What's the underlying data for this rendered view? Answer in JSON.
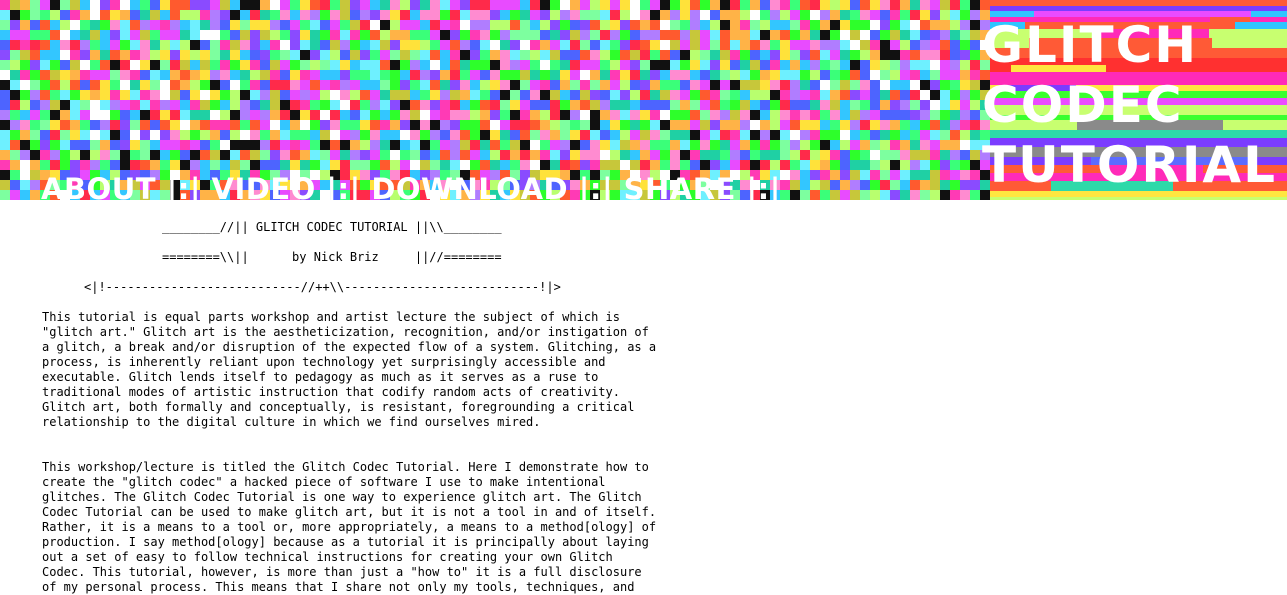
{
  "header": {
    "title_lines": [
      "GLITCH",
      "CODEC",
      "TUTORIAL"
    ],
    "nav": [
      {
        "label": "ABOUT"
      },
      {
        "label": "VIDEO"
      },
      {
        "label": "DOWNLOAD"
      },
      {
        "label": "SHARE"
      }
    ],
    "nav_separator": "|:|",
    "noise_palette": [
      "#ff3ab5",
      "#2dff2a",
      "#33c6ff",
      "#ffe23a",
      "#8a4bff",
      "#ff5a2e",
      "#b8ff6e",
      "#e84bff",
      "#1fd0a4",
      "#ffffff",
      "#4d64ff",
      "#ff8bd0",
      "#6ef0ff",
      "#c7c73a",
      "#ff2a4a",
      "#111111",
      "#7dff9f",
      "#b07dff",
      "#ffb347",
      "#3aff79"
    ],
    "stripe_palette": [
      "#ff2ab8",
      "#39ff2f",
      "#2fc5ff",
      "#ffe640",
      "#7b3cff",
      "#ff5a36",
      "#c8ff70",
      "#ea4bff",
      "#2ed9a9",
      "#ff3030",
      "#5c6bff",
      "#ff9ad2",
      "#8a8a8a"
    ]
  },
  "content": {
    "ascii_line_1": "________//|| GLITCH CODEC TUTORIAL ||\\\\________",
    "ascii_line_2": "========\\\\||      by Nick Briz     ||//========",
    "ascii_line_3": "<|!---------------------------//++\\\\---------------------------!|>",
    "paragraph_1": "This tutorial is equal parts workshop and artist lecture the subject of which is\n\"glitch art.\" Glitch art is the aestheticization, recognition, and/or instigation of\na glitch, a break and/or disruption of the expected flow of a system. Glitching, as a\nprocess, is inherently reliant upon technology yet surprisingly accessible and\nexecutable. Glitch lends itself to pedagogy as much as it serves as a ruse to\ntraditional modes of artistic instruction that codify random acts of creativity.\nGlitch art, both formally and conceptually, is resistant, foregrounding a critical\nrelationship to the digital culture in which we find ourselves mired.",
    "paragraph_2": "This workshop/lecture is titled the Glitch Codec Tutorial. Here I demonstrate how to\ncreate the \"glitch codec\" a hacked piece of software I use to make intentional\nglitches. The Glitch Codec Tutorial is one way to experience glitch art. The Glitch\nCodec Tutorial can be used to make glitch art, but it is not a tool in and of itself.\nRather, it is a means to a tool or, more appropriately, a means to a method[ology] of\nproduction. I say method[ology] because as a tutorial it is principally about laying\nout a set of easy to follow technical instructions for creating your own Glitch\nCodec. This tutorial, however, is more than just a \"how to\" it is a full disclosure\nof my personal process. This means that I share not only my tools, techniques, and"
  }
}
